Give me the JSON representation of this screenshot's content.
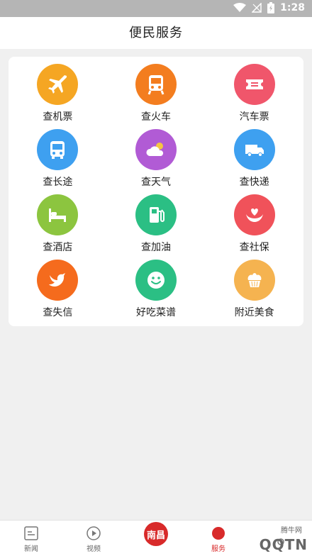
{
  "status": {
    "time": "1:28"
  },
  "header": {
    "title": "便民服务"
  },
  "services": [
    {
      "label": "查机票",
      "icon": "airplane-icon",
      "color": "#f5a623"
    },
    {
      "label": "查火车",
      "icon": "train-icon",
      "color": "#f37d1f"
    },
    {
      "label": "汽车票",
      "icon": "ticket-icon",
      "color": "#f0566b"
    },
    {
      "label": "查长途",
      "icon": "bus-icon",
      "color": "#3ea0f0"
    },
    {
      "label": "查天气",
      "icon": "weather-icon",
      "color": "#b15bd5"
    },
    {
      "label": "查快递",
      "icon": "truck-icon",
      "color": "#3ea0f0"
    },
    {
      "label": "查酒店",
      "icon": "bed-icon",
      "color": "#8cc53f"
    },
    {
      "label": "查加油",
      "icon": "fuel-icon",
      "color": "#2bbf84"
    },
    {
      "label": "查社保",
      "icon": "heart-hands-icon",
      "color": "#f0525a"
    },
    {
      "label": "查失信",
      "icon": "bird-icon",
      "color": "#f56b1d"
    },
    {
      "label": "好吃菜谱",
      "icon": "smile-icon",
      "color": "#2bbf84"
    },
    {
      "label": "附近美食",
      "icon": "cupcake-icon",
      "color": "#f5b350"
    }
  ],
  "bottom_nav": {
    "news": "新闻",
    "video": "视频",
    "center": "南昌",
    "services": "服务"
  },
  "watermark": {
    "text": "QQTN",
    "small": "腾牛网"
  }
}
